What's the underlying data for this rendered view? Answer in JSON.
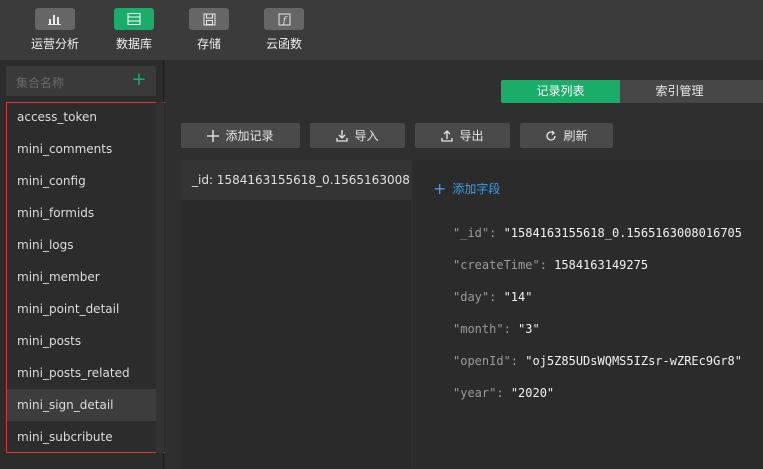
{
  "toolbar": {
    "items": [
      {
        "label": "运营分析",
        "icon": "bar-chart-icon"
      },
      {
        "label": "数据库",
        "icon": "database-icon"
      },
      {
        "label": "存储",
        "icon": "save-icon"
      },
      {
        "label": "云函数",
        "icon": "function-icon"
      }
    ],
    "active": "数据库",
    "accent": "#1aad6a"
  },
  "collections": {
    "search_placeholder": "集合名称",
    "items": [
      "access_token",
      "mini_comments",
      "mini_config",
      "mini_formids",
      "mini_logs",
      "mini_member",
      "mini_point_detail",
      "mini_posts",
      "mini_posts_related",
      "mini_sign_detail",
      "mini_subcribute"
    ],
    "selected": "mini_sign_detail"
  },
  "tabs": {
    "records": "记录列表",
    "indexes": "索引管理"
  },
  "actions": {
    "add_record": "添加记录",
    "import": "导入",
    "export": "导出",
    "refresh": "刷新"
  },
  "records": [
    "_id: 1584163155618_0.1565163008..."
  ],
  "detail": {
    "add_field": "添加字段",
    "fields": [
      {
        "key": "\"_id\"",
        "value": "\"1584163155618_0.1565163008016705"
      },
      {
        "key": "\"createTime\"",
        "value": "1584163149275"
      },
      {
        "key": "\"day\"",
        "value": "\"14\""
      },
      {
        "key": "\"month\"",
        "value": "\"3\""
      },
      {
        "key": "\"openId\"",
        "value": "\"oj5Z85UDsWQMS5IZsr-wZREc9Gr8\""
      },
      {
        "key": "\"year\"",
        "value": "\"2020\""
      }
    ]
  }
}
